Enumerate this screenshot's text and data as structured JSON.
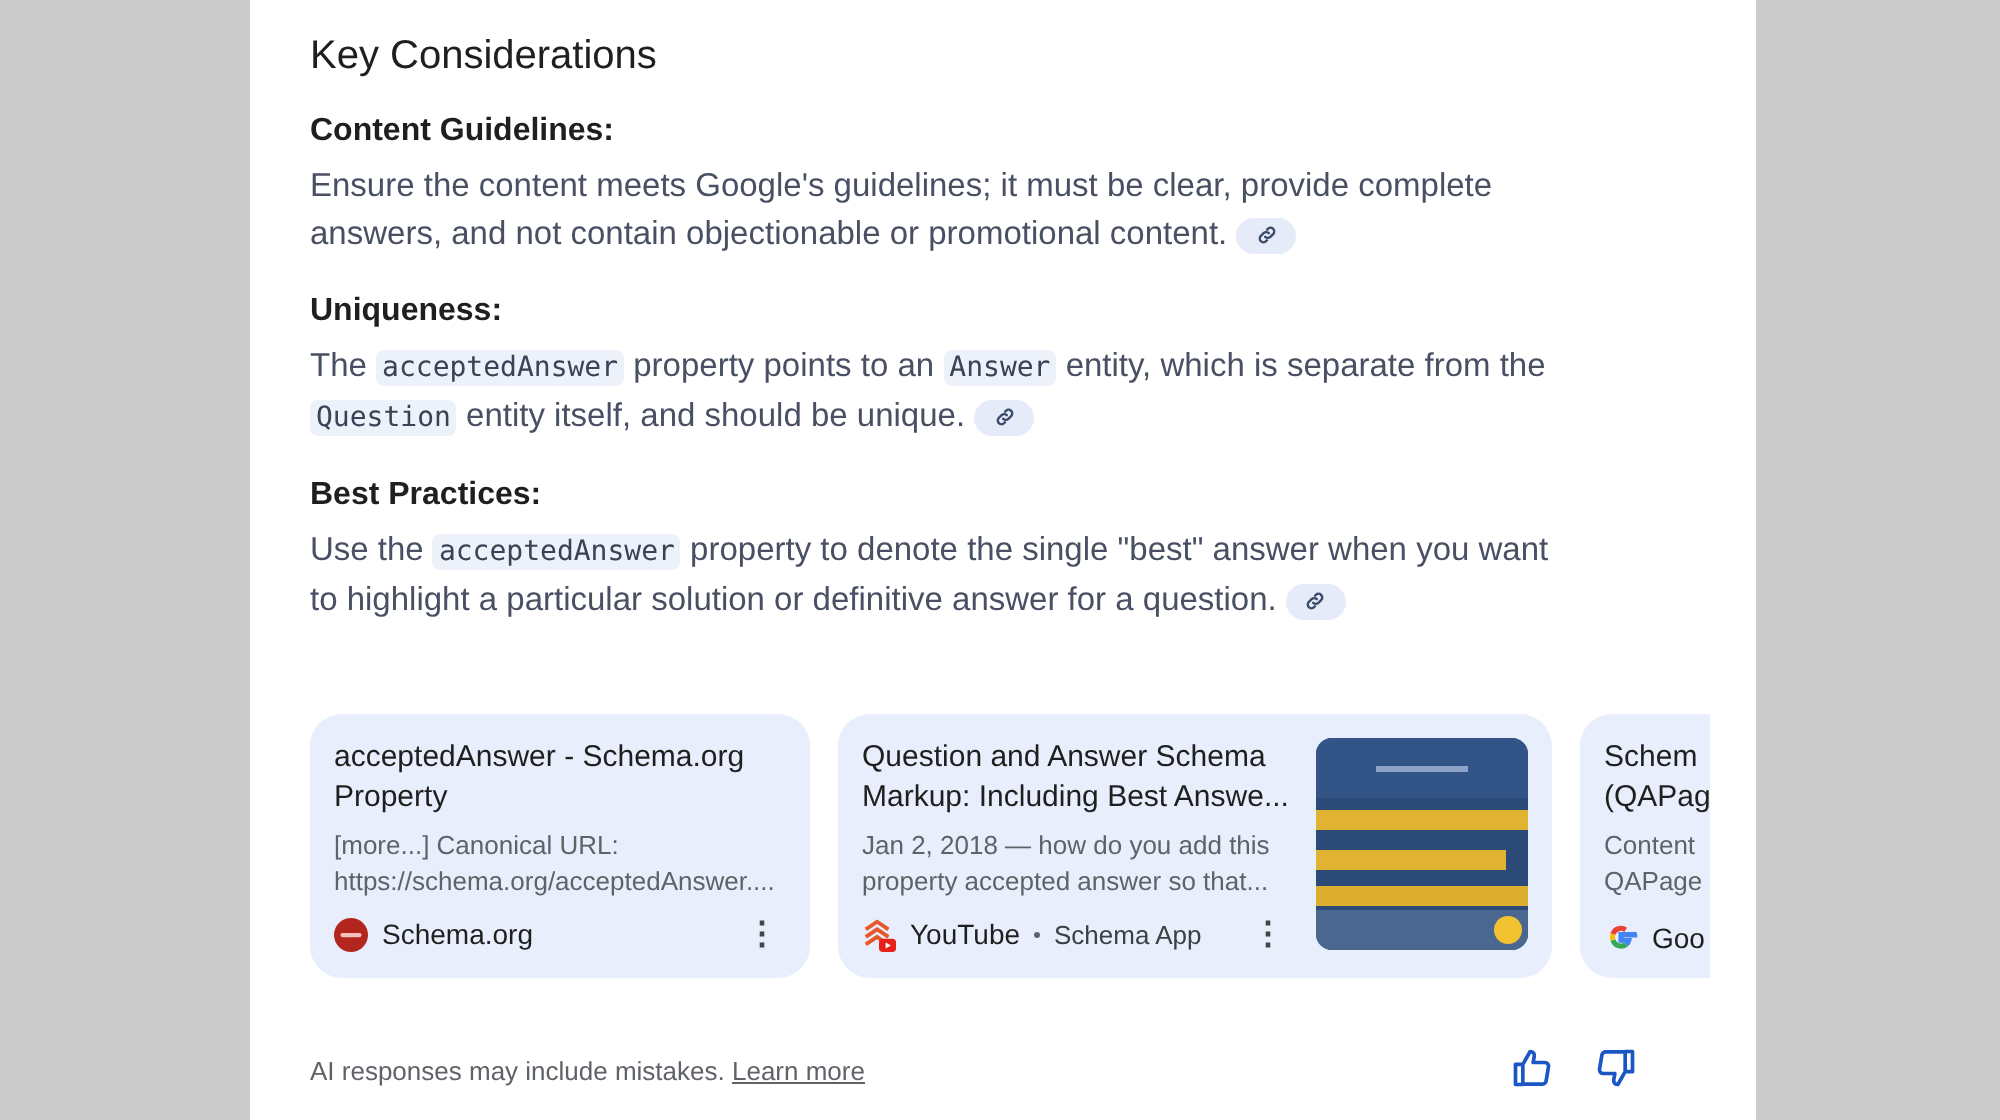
{
  "heading": "Key Considerations",
  "sections": [
    {
      "title": "Content Guidelines:",
      "body": [
        {
          "kind": "text",
          "text": "Ensure the content meets Google's guidelines; it must be clear, provide complete answers, and not contain objectionable or promotional content."
        }
      ]
    },
    {
      "title": "Uniqueness:",
      "body": [
        {
          "kind": "text",
          "text": "The "
        },
        {
          "kind": "code",
          "text": "acceptedAnswer"
        },
        {
          "kind": "text",
          "text": " property points to an "
        },
        {
          "kind": "code",
          "text": "Answer"
        },
        {
          "kind": "text",
          "text": " entity, which is separate from the "
        },
        {
          "kind": "code",
          "text": "Question"
        },
        {
          "kind": "text",
          "text": " entity itself, and should be unique."
        }
      ]
    },
    {
      "title": "Best Practices:",
      "body": [
        {
          "kind": "text",
          "text": "Use the "
        },
        {
          "kind": "code",
          "text": "acceptedAnswer"
        },
        {
          "kind": "text",
          "text": " property to denote the single \"best\" answer when you want to highlight a particular solution or definitive answer for a question."
        }
      ]
    }
  ],
  "sources": [
    {
      "kind": "plain",
      "title": "acceptedAnswer - Schema.org Property",
      "snippet": "[more...] Canonical URL: https://schema.org/acceptedAnswer....",
      "site": "Schema.org",
      "menu": "⋮"
    },
    {
      "kind": "video",
      "title": "Question and Answer Schema Markup: Including Best Answe...",
      "snippet": "Jan 2, 2018 — how do you add this property accepted answer so that...",
      "site": "YouTube",
      "author": "Schema App",
      "menu": "⋮"
    },
    {
      "kind": "partial",
      "title": "Schem (QAPag",
      "snippet": "Content QAPage",
      "site": "Goo"
    }
  ],
  "footer": {
    "disclaimer": "AI responses may include mistakes.",
    "link": "Learn more"
  }
}
